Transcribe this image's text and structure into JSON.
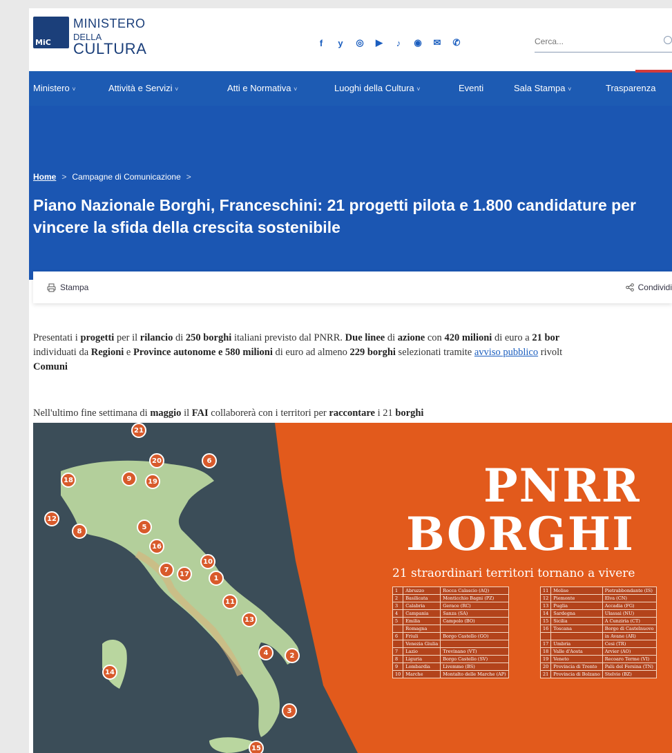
{
  "header": {
    "logo_line1": "MINISTERO",
    "logo_line2": "DELLA",
    "logo_line3": "CULTURA",
    "logo_mark": "MiC",
    "socials": [
      {
        "icon": "facebook-icon",
        "glyph": "f"
      },
      {
        "icon": "twitter-icon",
        "glyph": "y"
      },
      {
        "icon": "instagram-icon",
        "glyph": "◎"
      },
      {
        "icon": "youtube-icon",
        "glyph": "▶"
      },
      {
        "icon": "tiktok-icon",
        "glyph": "♪"
      },
      {
        "icon": "podcast-icon",
        "glyph": "◉"
      },
      {
        "icon": "mail-icon",
        "glyph": "✉"
      },
      {
        "icon": "phone-icon",
        "glyph": "✆"
      }
    ],
    "search_placeholder": "Cerca..."
  },
  "nav": {
    "items": [
      {
        "label": "Ministero",
        "has_dropdown": true
      },
      {
        "label": "Attività e Servizi",
        "has_dropdown": true
      },
      {
        "label": "Atti e Normativa",
        "has_dropdown": true
      },
      {
        "label": "Luoghi della Cultura",
        "has_dropdown": true
      },
      {
        "label": "Eventi",
        "has_dropdown": false
      },
      {
        "label": "Sala Stampa",
        "has_dropdown": true
      },
      {
        "label": "Trasparenza",
        "has_dropdown": false
      }
    ]
  },
  "breadcrumb": {
    "home": "Home",
    "section": "Campagne di Comunicazione"
  },
  "article": {
    "title": "Piano Nazionale Borghi, Franceschini: 21 progetti pilota e 1.800 candidature per vincere la sfida della crescita sostenibile",
    "print_label": "Stampa",
    "share_label": "Condividi",
    "lead": {
      "l1a": "Presentati i ",
      "l1b": "progetti",
      "l1c": " per il ",
      "l1d": "rilancio",
      "l1e": " di ",
      "l1f": "250 borghi",
      "l1g": " italiani previsto dal PNRR. ",
      "l1h": "Due linee",
      "l1i": " di ",
      "l1j": "azione",
      "l1k": " con ",
      "l1l": "420 milioni",
      "l1m": " di euro a ",
      "l1n": "21 bor",
      "l2a": "individuati da ",
      "l2b": "Regioni",
      "l2c": " e ",
      "l2d": "Province autonome e 580 milioni",
      "l2e": " di euro ad almeno ",
      "l2f": "229 borghi",
      "l2g": " selezionati tramite ",
      "l2h": "avviso pubblico",
      "l2i": " rivolt",
      "l3": "Comuni"
    },
    "para2": {
      "a": "Nell'ultimo fine settimana di ",
      "b": "maggio",
      "c": " il ",
      "d": "FAI",
      "e": " collaborerà con i territori per ",
      "f": "raccontare",
      "g": " i 21 ",
      "h": "borghi"
    }
  },
  "image": {
    "title1": "PNRR",
    "title2": "BORGHI",
    "subtitle": "21 straordinari territori tornano a vivere",
    "pins": [
      "21",
      "20",
      "6",
      "18",
      "9",
      "19",
      "12",
      "8",
      "5",
      "16",
      "10",
      "7",
      "17",
      "1",
      "11",
      "13",
      "4",
      "2",
      "14",
      "3",
      "15"
    ],
    "table_left": [
      [
        "1",
        "Abruzzo",
        "Rocca Calascio (AQ)"
      ],
      [
        "2",
        "Basilicata",
        "Monticchio Bagni (PZ)"
      ],
      [
        "3",
        "Calabria",
        "Gerace (RC)"
      ],
      [
        "4",
        "Campania",
        "Sanza (SA)"
      ],
      [
        "5",
        "Emilia",
        "Campolo (BO)"
      ],
      [
        "",
        "Romagna",
        ""
      ],
      [
        "6",
        "Friuli",
        "Borgo Castello (GO)"
      ],
      [
        "",
        "Venezia Giulia",
        ""
      ],
      [
        "7",
        "Lazio",
        "Trevinano (VT)"
      ],
      [
        "8",
        "Liguria",
        "Borgo Castello (SV)"
      ],
      [
        "9",
        "Lombardia",
        "Livemmo (BS)"
      ],
      [
        "10",
        "Marche",
        "Montalto delle Marche (AP)"
      ]
    ],
    "table_right": [
      [
        "11",
        "Molise",
        "Pietrabbondante (IS)"
      ],
      [
        "12",
        "Piemonte",
        "Elva (CN)"
      ],
      [
        "13",
        "Puglia",
        "Accadia (FG)"
      ],
      [
        "14",
        "Sardegna",
        "Ulassai (NU)"
      ],
      [
        "15",
        "Sicilia",
        "A Cunziria (CT)"
      ],
      [
        "16",
        "Toscana",
        "Borgo di Castelnuovo"
      ],
      [
        "",
        "",
        "in Avane (AR)"
      ],
      [
        "17",
        "Umbria",
        "Cesi (TR)"
      ],
      [
        "18",
        "Valle d'Aosta",
        "Arvier (AO)"
      ],
      [
        "19",
        "Veneto",
        "Recoaro Terme (VI)"
      ],
      [
        "20",
        "Provincia di Trento",
        "Palù del Fersina (TN)"
      ],
      [
        "21",
        "Provincia di Bolzano",
        "Stelvio (BZ)"
      ]
    ],
    "colors": {
      "sea": "#3a4b55",
      "orange": "#e25a1c",
      "land": "#bcd8a6",
      "pin": "#d85a2b"
    }
  }
}
